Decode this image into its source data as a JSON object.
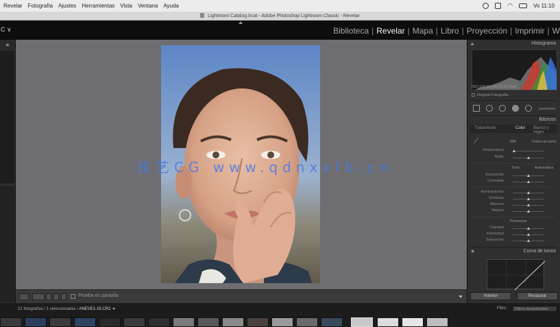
{
  "menubar": {
    "items": [
      "Revelar",
      "Fotografía",
      "Ajustes",
      "Herramientas",
      "Vista",
      "Ventana",
      "Ayuda"
    ],
    "clock": "Vo 11:10"
  },
  "titlebar": {
    "title": "Lightroom Catalog.lrcat - Adobe Photoshop Lightroom Classic - Revelar"
  },
  "modulebar": {
    "logo": "C ∨",
    "modules": [
      "Biblioteca",
      "Revelar",
      "Mapa",
      "Libro",
      "Proyección",
      "Imprimir",
      "W"
    ],
    "active": "Revelar"
  },
  "toolbar": {
    "soft_proofing": "Prueba en pantalla"
  },
  "right_panel": {
    "histogram_title": "Histograma",
    "histogram_info": "ISO 100  50 mm  f/2.8  1/500",
    "original_photo": "Original Fotografía",
    "basic_title": "Básicos",
    "treatment_tabs": [
      "Tratamiento",
      "Color",
      "Blanco y negro"
    ],
    "wb_label": "WB",
    "wb_value": "Como se tomó",
    "sliders_wb": [
      "Temperatura",
      "Matiz"
    ],
    "tone_label": "Tono",
    "tone_auto": "Automático",
    "sliders_tone": [
      "Exposición",
      "Contraste"
    ],
    "sliders_highlights": [
      "Iluminaciones",
      "Sombras",
      "Blancos",
      "Negros"
    ],
    "presence_label": "Presencia",
    "sliders_presence": [
      "Claridad",
      "Intensidad",
      "Saturación"
    ],
    "tone_curve_title": "Curva de tonos",
    "previous_button": "Anterior",
    "reset_button": "Restaurar"
  },
  "filmstrip": {
    "info_prefix": "21 fotografías / 1 seleccionadas /",
    "info_file": "ANEVE1-15.CR2",
    "filter_label": "Filtro :",
    "filter_value": "Filtros desactivados"
  },
  "watermark": "技艺CG www.qdnxxfb.cn",
  "colors": {
    "workspace_bg": "#6e6e70",
    "panel_bg": "#2f2f2f",
    "accent_blue": "#4678e6"
  },
  "slider_levels": {
    "wb": [
      0.05,
      0.5
    ],
    "tone": [
      0.5,
      0.5
    ],
    "highlights": [
      0.5,
      0.5,
      0.5,
      0.5
    ],
    "presence": [
      0.5,
      0.5,
      0.5
    ]
  }
}
